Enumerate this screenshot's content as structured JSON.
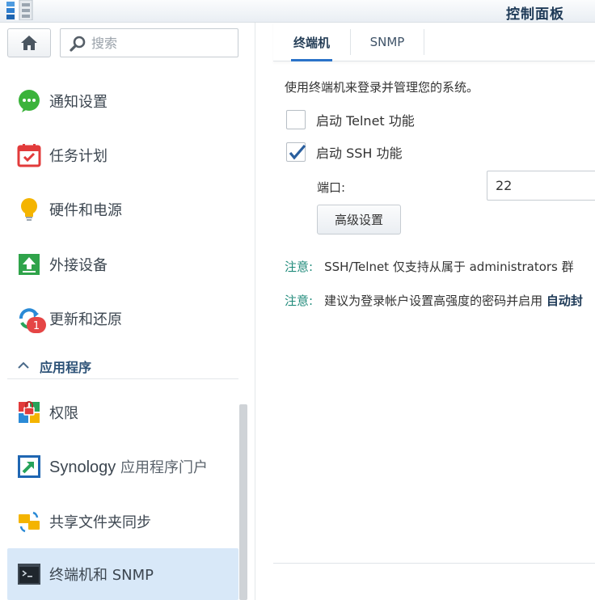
{
  "window": {
    "title": "控制面板"
  },
  "search": {
    "placeholder": "搜索"
  },
  "sidebar": {
    "items": [
      {
        "label": "通知设置",
        "icon": "chat-bubble-icon",
        "color": "#3bb33b"
      },
      {
        "label": "任务计划",
        "icon": "calendar-icon",
        "color": "#e23b3b"
      },
      {
        "label": "硬件和电源",
        "icon": "lightbulb-icon",
        "color": "#f4b400"
      },
      {
        "label": "外接设备",
        "icon": "upload-icon",
        "color": "#2fa34a"
      },
      {
        "label": "更新和还原",
        "icon": "refresh-icon",
        "badge": "1",
        "color": "#2a8ad6"
      }
    ],
    "section": {
      "label": "应用程序"
    },
    "app_items": [
      {
        "label": "权限",
        "icon": "permissions-icon"
      },
      {
        "label": "Synology",
        "label_suffix": " 应用程序门户",
        "icon": "portal-icon"
      },
      {
        "label": "共享文件夹同步",
        "icon": "folder-sync-icon"
      },
      {
        "label": "终端机和 SNMP",
        "icon": "terminal-icon",
        "active": true
      }
    ]
  },
  "tabs": [
    {
      "label": "终端机",
      "active": true
    },
    {
      "label": "SNMP",
      "active": false
    }
  ],
  "main": {
    "description": "使用终端机来登录并管理您的系统。",
    "telnet": {
      "label": "启动 Telnet 功能",
      "checked": false
    },
    "ssh": {
      "label": "启动 SSH 功能",
      "checked": true
    },
    "port": {
      "label": "端口:",
      "value": "22"
    },
    "advanced_button": "高级设置",
    "note1": {
      "tag": "注意:",
      "text": "SSH/Telnet 仅支持从属于 administrators 群"
    },
    "note2": {
      "tag": "注意:",
      "text": "建议为登录帐户设置高强度的密码并启用 ",
      "bold": "自动封"
    }
  },
  "colors": {
    "accent": "#2a73c9",
    "active_bg": "#d8e8f8",
    "note": "#1f8a7a"
  }
}
